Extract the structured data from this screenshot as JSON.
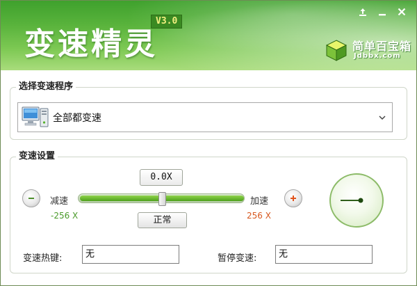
{
  "app": {
    "title": "变速精灵",
    "version": "V3.0"
  },
  "brand": {
    "name": "简单百宝箱",
    "url": "Jdbbx.com"
  },
  "program_section": {
    "title": "选择变速程序",
    "selected": "全部都变速"
  },
  "speed_section": {
    "title": "变速设置",
    "speed_value": "0.0X",
    "slider_level": 0.5,
    "decrease_label": "减速",
    "increase_label": "加速",
    "min_value": "-256 X",
    "max_value": "256 X",
    "normal_button": "正常"
  },
  "hotkeys": {
    "speed_label": "变速热键:",
    "speed_value": "无",
    "pause_label": "暂停变速:",
    "pause_value": "无"
  },
  "colors": {
    "header": "#59b33c",
    "dec_value": "#4a9a2a",
    "inc_value": "#d7581f"
  }
}
